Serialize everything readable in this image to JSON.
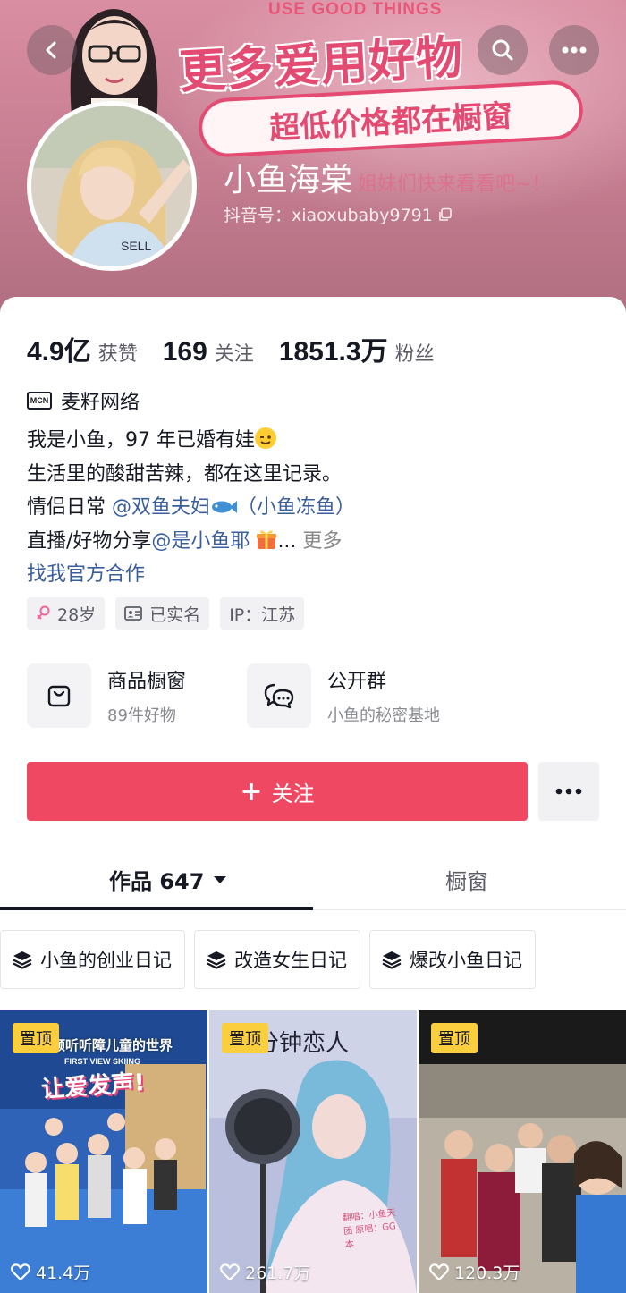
{
  "banner": {
    "title_en": "USE GOOD THINGS",
    "title": "更多爱用好物",
    "pill": "超低价格都在橱窗",
    "sub": "姐妹们快来看看吧~！"
  },
  "profile": {
    "nickname": "小鱼海棠",
    "douyin_id": "抖音号：xiaoxubaby9791"
  },
  "stats": [
    {
      "num": "4.9亿",
      "label": "获赞"
    },
    {
      "num": "169",
      "label": "关注"
    },
    {
      "num": "1851.3万",
      "label": "粉丝"
    }
  ],
  "mcn": {
    "badge": "MCN",
    "name": "麦籽网络"
  },
  "bio": {
    "line1": "我是小鱼，97 年已婚有娃",
    "line2": "生活里的酸甜苦辣，都在这里记录。",
    "line3_prefix": "情侣日常 ",
    "line3_link": "@双鱼夫妇",
    "line3_suffix": "（小鱼冻鱼）",
    "line4_prefix": "直播/好物分享",
    "line4_link": "@是小鱼耶",
    "line4_ellipsis": "...",
    "more": "更多",
    "cooperation": "找我官方合作"
  },
  "tags": {
    "age": "28岁",
    "verified": "已实名",
    "ip": "IP：江苏"
  },
  "services": {
    "shop_title": "商品橱窗",
    "shop_sub": "89件好物",
    "group_title": "公开群",
    "group_sub": "小鱼的秘密基地"
  },
  "actions": {
    "follow": "关注"
  },
  "tabs": {
    "works": "作品 647",
    "shop": "橱窗"
  },
  "collections": [
    "小鱼的创业日记",
    "改造女生日记",
    "爆改小鱼日记"
  ],
  "videos": [
    {
      "pin": "置顶",
      "likes": "41.4万",
      "caption_top": "倾听听障儿童的世界",
      "caption_main": "让爱发声!",
      "caption_small": "FIRST VIEW SKIING"
    },
    {
      "pin": "置顶",
      "likes": "261.7万",
      "caption_top": "分钟恋人",
      "caption_small": "翻唱：小鱼天团 原唱：GG本"
    },
    {
      "pin": "置顶",
      "likes": "120.3万"
    }
  ],
  "colors": {
    "accent": "#ee4863",
    "link": "#3a5d9c",
    "pin": "#fbce3e",
    "banner": "#c97f93"
  },
  "icons": {
    "back": "chevron-left-icon",
    "search": "search-icon",
    "more": "more-dots-icon",
    "copy": "copy-icon",
    "shop": "shopping-bag-icon",
    "group": "chat-bubbles-icon",
    "heart": "heart-outline-icon",
    "collection": "layers-icon"
  }
}
